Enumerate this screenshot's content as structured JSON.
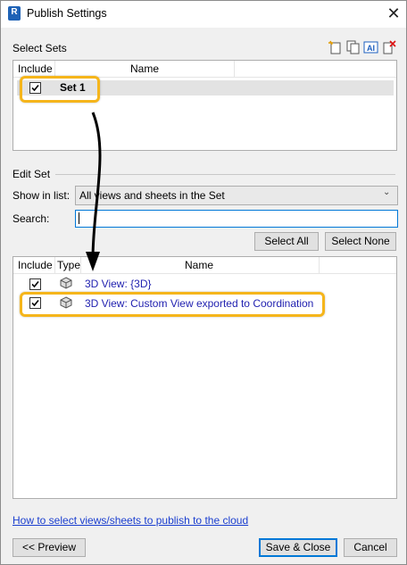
{
  "window": {
    "title": "Publish Settings",
    "app_icon": "R"
  },
  "select_sets": {
    "label": "Select Sets",
    "toolbar_icons": [
      "new-set-icon",
      "duplicate-icon",
      "rename-icon",
      "delete-icon"
    ],
    "columns": [
      "Include",
      "Name"
    ],
    "rows": [
      {
        "checked": true,
        "name": "Set 1"
      }
    ]
  },
  "edit_set": {
    "label": "Edit Set",
    "show_in_list_label": "Show in list:",
    "show_in_list_value": "All views and sheets in the Set",
    "search_label": "Search:",
    "search_value": "",
    "select_all": "Select All",
    "select_none": "Select None",
    "columns": [
      "Include",
      "Type",
      "Name"
    ],
    "rows": [
      {
        "checked": true,
        "type_icon": "3d-view-icon",
        "name": "3D View: {3D}"
      },
      {
        "checked": true,
        "type_icon": "3d-view-icon",
        "name": "3D View: Custom View exported to Coordination"
      }
    ]
  },
  "help_link": "How to select views/sheets to publish to the cloud",
  "buttons": {
    "preview": "<< Preview",
    "save_close": "Save & Close",
    "cancel": "Cancel"
  },
  "colors": {
    "highlight": "#f5b51b",
    "link": "#1a3ecf",
    "accent": "#0078d7"
  }
}
